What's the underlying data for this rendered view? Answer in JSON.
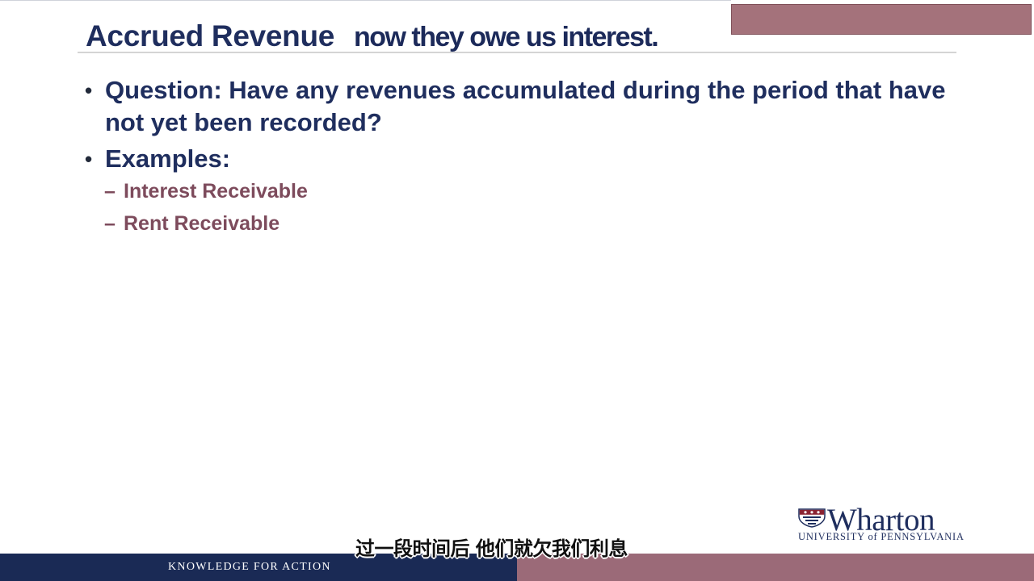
{
  "slide": {
    "title": "Accrued Revenue",
    "caption_en": "now they owe us interest.",
    "caption_cn": "过一段时间后 他们就欠我们利息",
    "bullets": [
      {
        "text": "Question:  Have any revenues accumulated during the period that have not yet been recorded?"
      },
      {
        "text": "Examples:"
      }
    ],
    "sub_items": [
      {
        "text": "Interest Receivable"
      },
      {
        "text": "Rent Receivable"
      }
    ],
    "bullet_marker": "•",
    "sub_marker": "–",
    "logo": {
      "name": "Wharton",
      "subtitle": "UNIVERSITY of PENNSYLVANIA",
      "icon": "penn-shield-icon"
    },
    "footer_text": "KNOWLEDGE FOR ACTION"
  },
  "colors": {
    "navy": "#1f2e5e",
    "maroon": "#9b6a78",
    "sub_text": "#7d4b5c",
    "footer_navy": "#1a2a55",
    "top_box": "#a4727b"
  }
}
